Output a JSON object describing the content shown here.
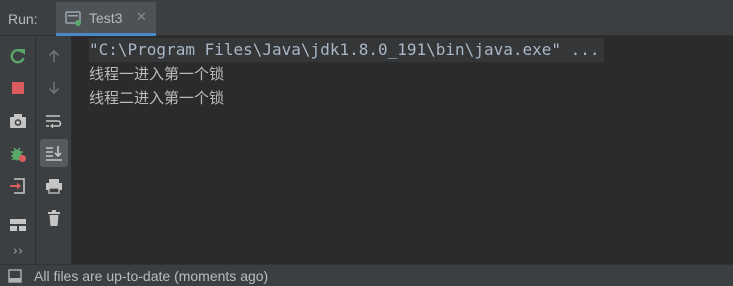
{
  "run_panel": {
    "label": "Run:",
    "tab": {
      "title": "Test3",
      "close_glyph": "✕",
      "icon": "run-config-icon"
    }
  },
  "left_toolbar": {
    "buttons": [
      {
        "name": "rerun-icon",
        "color": "#59a869"
      },
      {
        "name": "stop-icon",
        "color": "#db5c5c"
      },
      {
        "name": "camera-icon",
        "color": "#c5c5c5"
      },
      {
        "name": "debug-bug-icon",
        "color": "#59a869"
      },
      {
        "name": "exit-icon",
        "color": "#db5c5c"
      },
      {
        "name": "layout-icon",
        "color": "#c5c5c5"
      }
    ],
    "more_glyph": "››"
  },
  "console_toolbar": {
    "buttons": [
      "up-arrow-icon",
      "down-arrow-icon",
      "soft-wrap-icon",
      "scroll-to-end-icon",
      "print-icon",
      "trash-icon"
    ]
  },
  "console": {
    "lines": [
      "\"C:\\Program Files\\Java\\jdk1.8.0_191\\bin\\java.exe\" ...",
      "线程一进入第一个锁",
      "线程二进入第一个锁"
    ]
  },
  "status_bar": {
    "text": "All files are up-to-date (moments ago)",
    "icon": "window-layout-icon"
  },
  "colors": {
    "panel": "#3c3f41",
    "editor": "#2b2b2b",
    "accent": "#4a88c7",
    "run_green": "#59a869",
    "stop_red": "#db5c5c"
  }
}
